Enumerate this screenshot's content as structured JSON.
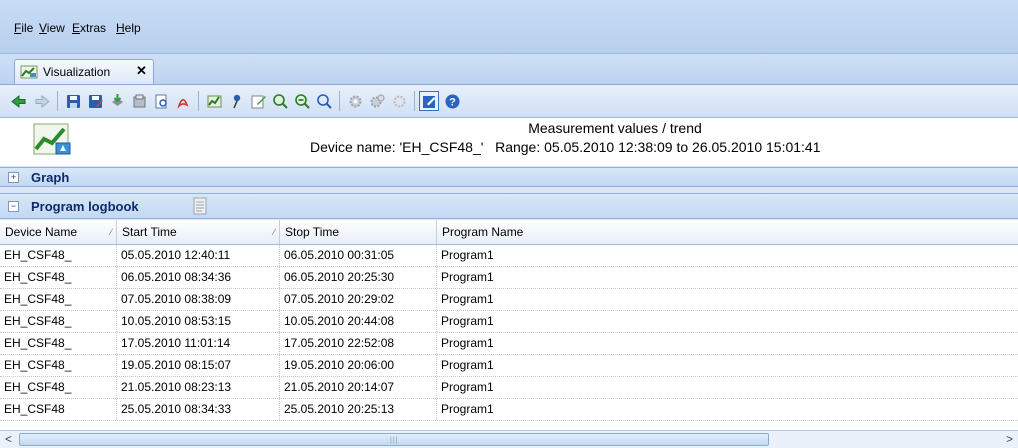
{
  "menu": {
    "items": [
      {
        "label": "File",
        "accel": "F"
      },
      {
        "label": "View",
        "accel": "V"
      },
      {
        "label": "Extras",
        "accel": "E"
      },
      {
        "label": "Help",
        "accel": "H"
      }
    ]
  },
  "tab": {
    "label": "Visualization",
    "close": "✕"
  },
  "toolbar": {
    "icons": [
      "back-arrow-icon",
      "forward-arrow-icon",
      "save-icon",
      "save-as-icon",
      "import-icon",
      "export-icon",
      "print-preview-icon",
      "pdf-icon",
      "chart-settings-icon",
      "pin-icon",
      "annotate-icon",
      "zoom-in-icon",
      "zoom-out-icon",
      "zoom-fit-icon",
      "gear-icon",
      "gear-multi-icon",
      "gear-disabled-icon",
      "edit-settings-icon",
      "help-icon"
    ]
  },
  "header": {
    "title": "Measurement values / trend",
    "device_line": "Device name: 'EH_CSF48_'   Range: 05.05.2010 12:38:09 to 26.05.2010 15:01:41"
  },
  "sections": {
    "graph": {
      "label": "Graph",
      "toggle": "+"
    },
    "logbook": {
      "label": "Program logbook",
      "toggle": "−"
    }
  },
  "table": {
    "columns": [
      "Device Name",
      "Start Time",
      "Stop Time",
      "Program Name"
    ],
    "rows": [
      [
        "EH_CSF48_",
        "05.05.2010 12:40:11",
        "06.05.2010 00:31:05",
        "Program1"
      ],
      [
        "EH_CSF48_",
        "06.05.2010 08:34:36",
        "06.05.2010 20:25:30",
        "Program1"
      ],
      [
        "EH_CSF48_",
        "07.05.2010 08:38:09",
        "07.05.2010 20:29:02",
        "Program1"
      ],
      [
        "EH_CSF48_",
        "10.05.2010 08:53:15",
        "10.05.2010 20:44:08",
        "Program1"
      ],
      [
        "EH_CSF48_",
        "17.05.2010 11:01:14",
        "17.05.2010 22:52:08",
        "Program1"
      ],
      [
        "EH_CSF48_",
        "19.05.2010 08:15:07",
        "19.05.2010 20:06:00",
        "Program1"
      ],
      [
        "EH_CSF48_",
        "21.05.2010 08:23:13",
        "21.05.2010 20:14:07",
        "Program1"
      ],
      [
        "EH_CSF48",
        "25.05.2010 08:34:33",
        "25.05.2010 20:25:13",
        "Program1"
      ]
    ]
  },
  "scrollbar": {
    "left": "<",
    "right": ">"
  }
}
